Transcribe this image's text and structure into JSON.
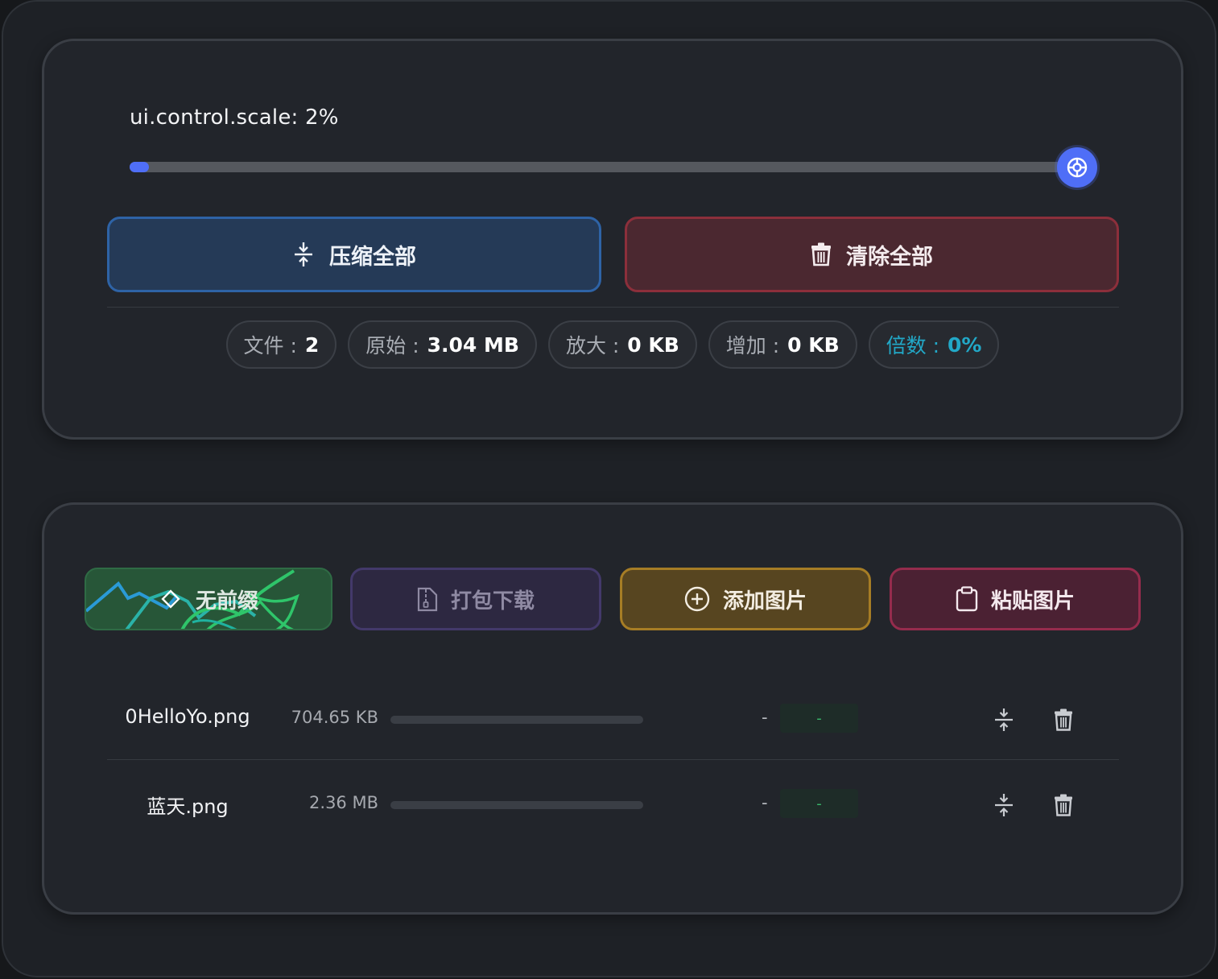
{
  "scale": {
    "label": "ui.control.scale: 2%",
    "value_percent": 2,
    "accent_color": "#4f6ef7"
  },
  "toolbar": {
    "compress_all_label": "压缩全部",
    "clear_all_label": "清除全部"
  },
  "stats": {
    "files_label": "文件 :",
    "files_value": "2",
    "original_label": "原始 :",
    "original_value": "3.04 MB",
    "enlarged_label": "放大 :",
    "enlarged_value": "0 KB",
    "increase_label": "增加 :",
    "increase_value": "0 KB",
    "ratio_label": "倍数 :",
    "ratio_value": "0%"
  },
  "actions": {
    "prefix_label": "无前缀",
    "zip_label": "打包下载",
    "add_label": "添加图片",
    "paste_label": "粘贴图片"
  },
  "files": [
    {
      "name": "0HelloYo.png",
      "size": "704.65 KB",
      "progress": 0,
      "dash": "-",
      "result": "-"
    },
    {
      "name": "蓝天.png",
      "size": "2.36 MB",
      "progress": 0,
      "dash": "-",
      "result": "-"
    }
  ],
  "icons": {
    "compress": "compress-icon",
    "trash": "trash-icon",
    "zip": "file-zip-icon",
    "add": "plus-circle-icon",
    "paste": "clipboard-icon",
    "prefix": "diamond-icon",
    "thumb": "lifebuoy-icon"
  }
}
